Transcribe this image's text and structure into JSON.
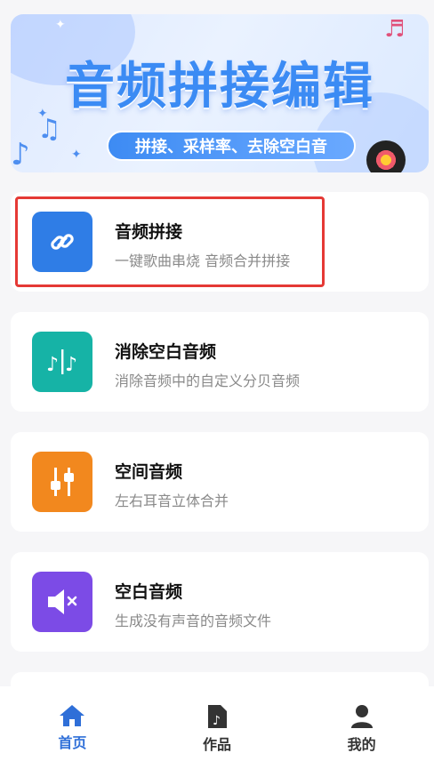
{
  "banner": {
    "title": "音频拼接编辑",
    "subtitle": "拼接、采样率、去除空白音"
  },
  "features": [
    {
      "title": "音频拼接",
      "subtitle": "一键歌曲串烧 音频合并拼接",
      "icon": "link-icon",
      "color": "#2f7de6"
    },
    {
      "title": "消除空白音频",
      "subtitle": "消除音频中的自定义分贝音频",
      "icon": "music-split-icon",
      "color": "#16b3a6"
    },
    {
      "title": "空间音频",
      "subtitle": "左右耳音立体合并",
      "icon": "sliders-icon",
      "color": "#f2881e"
    },
    {
      "title": "空白音频",
      "subtitle": "生成没有声音的音频文件",
      "icon": "mute-speaker-icon",
      "color": "#7c4be6"
    }
  ],
  "tabs": [
    {
      "label": "首页",
      "icon": "home-icon",
      "active": true
    },
    {
      "label": "作品",
      "icon": "music-file-icon",
      "active": false
    },
    {
      "label": "我的",
      "icon": "user-icon",
      "active": false
    }
  ],
  "colors": {
    "accent": "#2f6fd8",
    "highlight_border": "#e53935",
    "background": "#f6f6f8"
  }
}
